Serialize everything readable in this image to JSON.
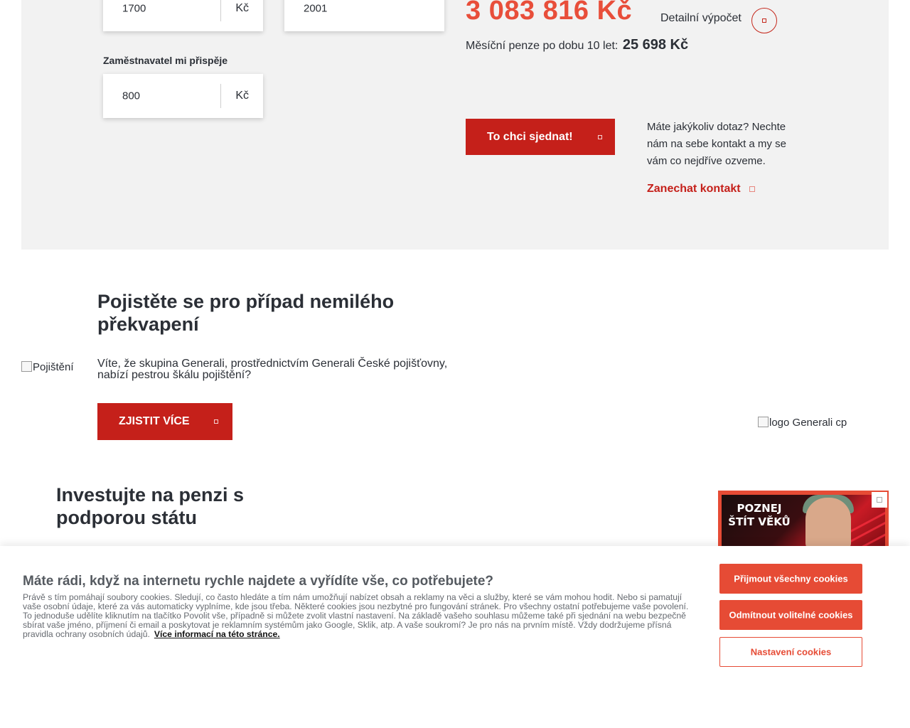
{
  "calculator": {
    "my_contribution": {
      "value": "1700",
      "unit": "Kč"
    },
    "birth_year": {
      "value": "2001"
    },
    "employer_label": "Zaměstnavatel mi přispěje",
    "employer_contribution": {
      "value": "800",
      "unit": "Kč"
    },
    "total_amount": "3 083 816 Kč",
    "detail_link": "Detailní výpočet",
    "monthly_label": "Měsíční penze po dobu 10 let:",
    "monthly_amount": "25 698 Kč",
    "cta_label": "To chci sjednat!",
    "contact_text": "Máte jakýkoliv dotaz? Nechte nám na sebe kontakt a my se vám co nejdříve ozveme.",
    "contact_link": "Zanechat kontakt"
  },
  "insurance": {
    "image_alt": "Pojištění",
    "title": "Pojistěte se pro případ nemilého překvapení",
    "description": "Víte, že skupina Generali, prostřednictvím Generali České pojišťovny, nabízí pestrou škálu pojištění?",
    "button_label": "ZJISTIT VÍCE",
    "logo_alt": "logo Generali cp"
  },
  "investment": {
    "title": "Investujte na penzi s podporou státu"
  },
  "promo": {
    "text": "POZNEJ ŠTÍT VĚKŮ"
  },
  "cookies": {
    "title": "Máte rádi, když na internetu rychle najdete a vyřídíte vše, co potřebujete?",
    "text": "Právě s tím pomáhají soubory cookies. Sledují, co často hledáte a tím nám umožňují nabízet obsah a reklamy na věci a služby, které se vám mohou hodit. Nebo si pamatují vaše osobní údaje, které za vás automaticky vyplníme, kde jsou třeba. Některé cookies jsou nezbytné pro fungování stránek. Pro všechny ostatní potřebujeme vaše povolení. To jednoduše udělíte kliknutím na tlačítko Povolit vše, případně si můžete zvolit vlastní nastavení. Na základě vašeho souhlasu můžeme také při sjednání na webu bezpečně sbírat vaše jméno, příjmení či email a poskytovat je reklamním systémům jako Google, Sklik, atp. A vaše soukromí? Je pro nás na prvním místě. Vždy dodržujeme přísná pravidla ochrany osobních údajů.",
    "more_link": "Více informací na této stránce.",
    "accept_all": "Přijmout všechny cookies",
    "reject_optional": "Odmítnout volitelné cookies",
    "settings": "Nastavení cookies"
  },
  "colors": {
    "brand_red": "#c5201a",
    "accent_orange": "#e84e3a",
    "panel_gray": "#f2f2f2",
    "text_dark": "#2b2f36"
  }
}
